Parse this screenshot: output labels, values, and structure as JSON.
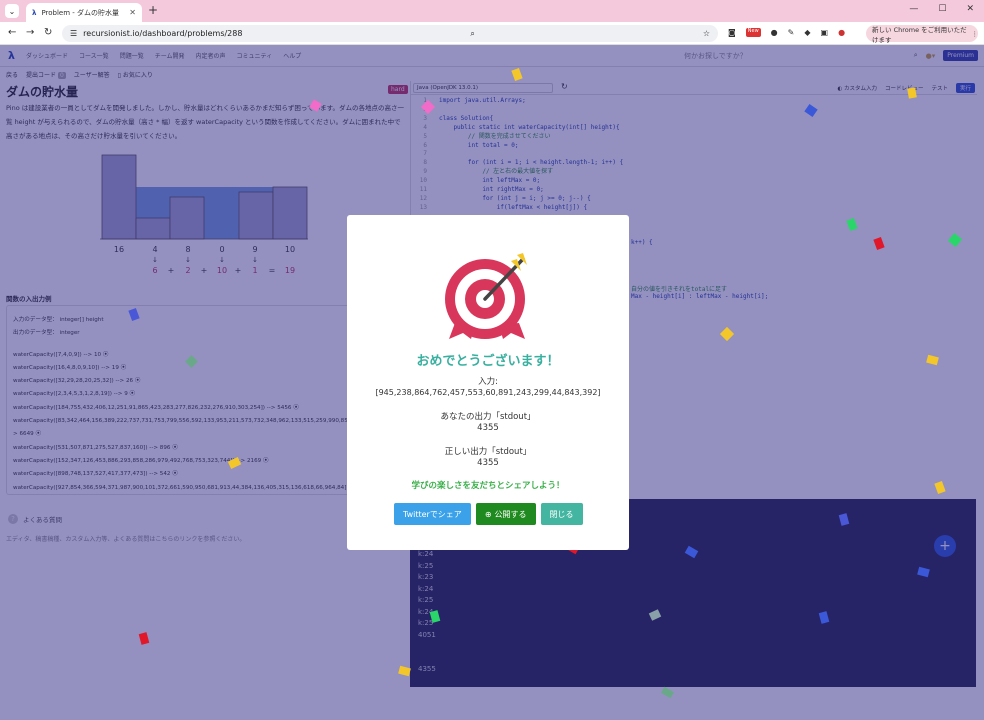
{
  "browser": {
    "tab_title": "Problem - ダムの貯水量",
    "url": "recursionist.io/dashboard/problems/288",
    "update_label": "新しい Chrome をご利用いただけます",
    "new_badge": "New"
  },
  "site": {
    "nav": [
      "ダッシュボード",
      "コース一覧",
      "問題一覧",
      "チーム開発",
      "内定者の声",
      "コミュニティ",
      "ヘルプ"
    ],
    "search_placeholder": "何かお探しですか？",
    "premium": "Premium",
    "subnav": [
      "戻る",
      "提出コード",
      "ユーザー解答",
      "お気に入り"
    ],
    "subnav_badge": "0"
  },
  "problem": {
    "title": "ダムの貯水量",
    "difficulty": "hard",
    "description": "Pino は建設業者の一員としてダムを開発しました。しかし、貯水量はどれくらいあるかまだ知らず困っています。ダムの各地点の高さ一覧 height が与えられるので、ダムの貯水量（高さ * 幅）を返す waterCapacity という関数を作成してください。ダムに囲まれた中で高さがある地点は、その高さだけ貯水量を引いてください。",
    "heights": [
      "16",
      "4",
      "8",
      "0",
      "9",
      "10"
    ],
    "arrows": [
      "↓",
      "↓",
      "↓",
      "↓"
    ],
    "water_terms": [
      "6",
      "2",
      "10",
      "1"
    ],
    "ops": [
      "+",
      "+",
      "+",
      "+",
      "="
    ],
    "total": "19"
  },
  "io": {
    "heading": "関数の入出力例",
    "input_type": "入力のデータ型： integer[] height",
    "output_type": "出力のデータ型： integer",
    "examples": [
      "waterCapacity([7,4,0,9]) --> 10 ⦿",
      "waterCapacity([16,4,8,0,9,10]) --> 19 ⦿",
      "waterCapacity([32,29,28,20,25,32]) --> 26 ⦿",
      "waterCapacity([2,3,4,5,3,1,2,8,19]) --> 9 ⦿",
      "waterCapacity([184,755,432,406,12,251,91,865,423,283,277,826,232,276,910,303,254]) --> 5456 ⦿",
      "waterCapacity([83,342,464,156,389,222,737,731,753,799,556,592,133,953,211,573,732,348,962,133,515,259,990,850,373,556,470]) --> 6649 ⦿",
      "waterCapacity([531,507,871,275,527,837,160]) --> 896 ⦿",
      "waterCapacity([152,347,126,453,886,293,858,286,979,492,768,753,323,744]) --> 2169 ⦿",
      "waterCapacity([898,748,137,527,417,377,473]) --> 542 ⦿",
      "waterCapacity([927,854,366,594,371,987,900,101,372,661,590,950,681,913,44,384,136,405,315,136,618,66,964,84]) --> 9675 ⦿"
    ],
    "faq_title": "よくある質問",
    "faq_text": "エディタ、稿書稿種、カスタム入力等、よくある質問はこちらのリンクを参照ください。"
  },
  "editor": {
    "language": "Java (OpenJDK 13.0.1)",
    "custom_input": "カスタム入力",
    "code_review": "コードレビュー",
    "test": "テスト",
    "run": "実行",
    "lines": [
      {
        "n": "1",
        "t": "import java.util.Arrays;"
      },
      {
        "n": "2",
        "t": ""
      },
      {
        "n": "3",
        "t": "class Solution{"
      },
      {
        "n": "4",
        "t": "    public static int waterCapacity(int[] height){"
      },
      {
        "n": "5",
        "t": "        // 関数を完成させてください"
      },
      {
        "n": "6",
        "t": "        int total = 0;"
      },
      {
        "n": "7",
        "t": ""
      },
      {
        "n": "8",
        "t": "        for (int i = 1; i < height.length-1; i++) {"
      },
      {
        "n": "9",
        "t": "            // 左と右の最大値を探す"
      },
      {
        "n": "10",
        "t": "            int leftMax = 0;"
      },
      {
        "n": "11",
        "t": "            int rightMax = 0;"
      },
      {
        "n": "12",
        "t": "            for (int j = i; j >= 0; j--) {"
      },
      {
        "n": "13",
        "t": "                if(leftMax < height[j]) {"
      }
    ],
    "fragment1": "k++) {",
    "fragment2": "自分の値を引きそれをtotalに足す",
    "fragment3": "Max - height[i] : leftMax - height[i];"
  },
  "console": {
    "lines": [
      "k:24",
      "k:25",
      "k:23",
      "k:24",
      "k:25",
      "k:24",
      "k:25",
      "4051",
      "",
      "4355"
    ]
  },
  "modal": {
    "title": "おめでとうございます！",
    "input_label": "入力:",
    "input_value": "[945,238,864,762,457,553,60,891,243,299,44,843,392]",
    "your_output_label": "あなたの出力「stdout」",
    "your_output_value": "4355",
    "correct_output_label": "正しい出力「stdout」",
    "correct_output_value": "4355",
    "share_text": "学びの楽しさを友だちとシェアしよう！",
    "twitter_button": "Twitterでシェア",
    "publish_button": "公開する",
    "close_button": "閉じる"
  },
  "colors": {
    "accent": "#38b0a0",
    "overlay": "#2a2482",
    "water": "#4a7fd4",
    "bar": "#a7a5cf",
    "target_red": "#d8365a"
  }
}
